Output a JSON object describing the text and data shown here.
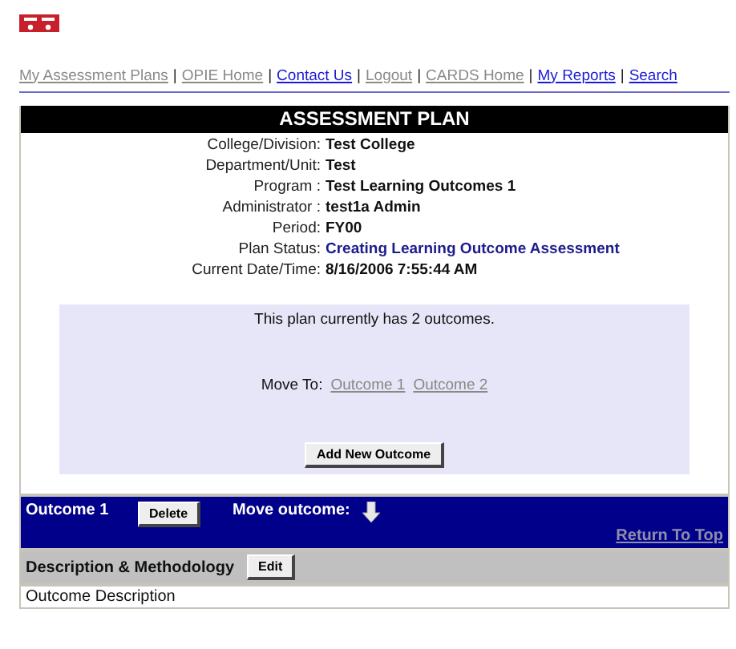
{
  "nav_links": [
    {
      "label": "My Assessment Plans",
      "visited": true,
      "separator": "|"
    },
    {
      "label": "OPIE Home ",
      "visited": true,
      "separator": "|"
    },
    {
      "label": "Contact Us ",
      "visited": false,
      "separator": "|"
    },
    {
      "label": "Logout ",
      "visited": true,
      "separator": "|"
    },
    {
      "label": "CARDS Home ",
      "visited": true,
      "separator": "|"
    },
    {
      "label": "My Reports",
      "visited": false,
      "separator": "|"
    },
    {
      "label": "Search",
      "visited": false
    }
  ],
  "plan": {
    "title": "ASSESSMENT PLAN",
    "fields": [
      {
        "label": "College/Division:",
        "value": "Test College",
        "kind": "plain"
      },
      {
        "label": "Department/Unit:",
        "value": "Test",
        "kind": "plain"
      },
      {
        "label": "Program :",
        "value": "Test Learning Outcomes 1",
        "kind": "plain"
      },
      {
        "label": "Administrator :",
        "value": "test1a Admin",
        "kind": "plain"
      },
      {
        "label": "Period:",
        "value": "FY00",
        "kind": "plain"
      },
      {
        "label": "Plan Status:",
        "value": "Creating Learning Outcome Assessment",
        "kind": "status"
      },
      {
        "label": "Current Date/Time:",
        "value": "8/16/2006 7:55:44 AM",
        "kind": "plain"
      }
    ]
  },
  "outcomes_box": {
    "summary": "This plan currently has 2 outcomes.",
    "move_to_label": "Move To:",
    "move_to_links": [
      "Outcome 1",
      "Outcome 2"
    ],
    "add_button": "Add New Outcome"
  },
  "outcome": {
    "title": "Outcome 1",
    "delete_button": "Delete",
    "move_label": "Move outcome:",
    "return_link": "Return To Top",
    "section_title": "Description & Methodology",
    "edit_button": "Edit",
    "row_label": "Outcome Description"
  }
}
